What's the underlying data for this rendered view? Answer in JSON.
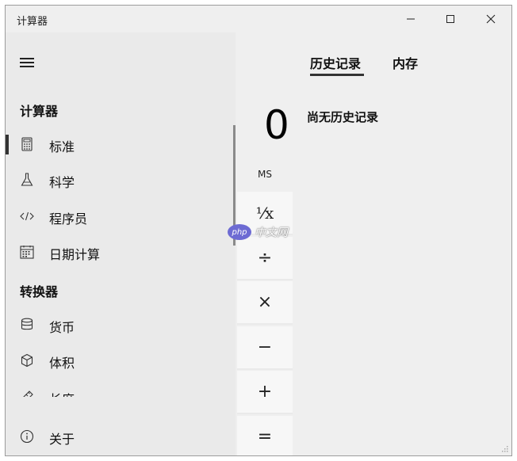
{
  "window": {
    "title": "计算器",
    "controls": {
      "minimize": "minimize-icon",
      "maximize": "maximize-icon",
      "close": "close-icon"
    }
  },
  "nav": {
    "menu_icon": "hamburger-icon",
    "calculator_header": "计算器",
    "calculator_items": [
      {
        "label": "标准",
        "icon": "calculator-icon",
        "selected": true
      },
      {
        "label": "科学",
        "icon": "flask-icon",
        "selected": false
      },
      {
        "label": "程序员",
        "icon": "code-icon",
        "selected": false
      },
      {
        "label": "日期计算",
        "icon": "calendar-icon",
        "selected": false
      }
    ],
    "converter_header": "转换器",
    "converter_items": [
      {
        "label": "货币",
        "icon": "currency-icon"
      },
      {
        "label": "体积",
        "icon": "cube-icon"
      },
      {
        "label": "长度",
        "icon": "ruler-icon"
      }
    ],
    "about": {
      "label": "关于",
      "icon": "info-icon"
    }
  },
  "calculator": {
    "display": "0",
    "memory_store": "MS",
    "keys": [
      "⅟x",
      "÷",
      "×",
      "−",
      "+",
      "="
    ]
  },
  "history_pane": {
    "tabs": [
      {
        "label": "历史记录",
        "active": true
      },
      {
        "label": "内存",
        "active": false
      }
    ],
    "empty_text": "尚无历史记录"
  },
  "watermark": {
    "logo": "php",
    "text": "中文网"
  }
}
